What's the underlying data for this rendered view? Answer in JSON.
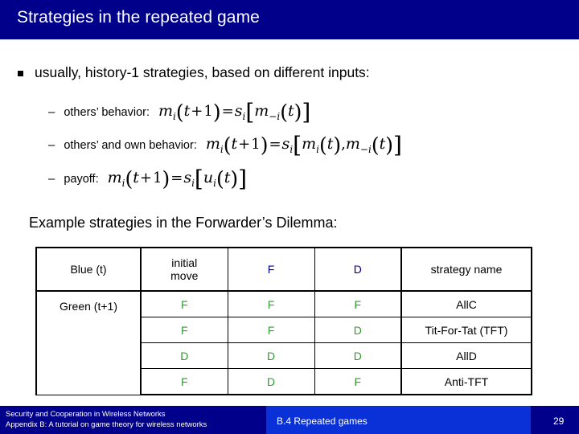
{
  "slide": {
    "title": "Strategies in the repeated game",
    "colors": {
      "title_bar": "#00008B",
      "footer_dark": "#00008B",
      "footer_bright": "#0A31D8",
      "header_accent": "#00008B",
      "cell_accent": "#2E9B2E"
    }
  },
  "bullets": {
    "main": "usually, history-1 strategies, based on different inputs:",
    "sub": [
      {
        "label": "others’ behavior:",
        "formula_text": "m_i(t+1) = s_i[ m_-i(t) ]"
      },
      {
        "label": "others’ and own behavior:",
        "formula_text": "m_i(t+1) = s_i[ m_i(t), m_-i(t) ]"
      },
      {
        "label": "payoff:",
        "formula_text": "m_i(t+1) = s_i[ u_i(t) ]"
      }
    ]
  },
  "example": {
    "caption": "Example strategies in the Forwarder’s Dilemma:"
  },
  "table": {
    "row_label_top": "Blue (t)",
    "row_label_bottom": "Green (t+1)",
    "headers": [
      "initial",
      "move",
      "F",
      "D",
      "strategy name"
    ],
    "header_initial_line1": "initial",
    "header_initial_line2": "move",
    "header_f": "F",
    "header_d": "D",
    "header_strategy_name": "strategy name",
    "rows": [
      {
        "initial": "F",
        "f": "F",
        "d": "F",
        "name": "AllC"
      },
      {
        "initial": "F",
        "f": "F",
        "d": "D",
        "name": "Tit-For-Tat (TFT)"
      },
      {
        "initial": "D",
        "f": "D",
        "d": "D",
        "name": "AllD"
      },
      {
        "initial": "F",
        "f": "D",
        "d": "F",
        "name": "Anti-TFT"
      }
    ]
  },
  "footer": {
    "line1": "Security and Cooperation in Wireless Networks",
    "line2": "Appendix B: A tutorial on game theory for wireless networks",
    "section": "B.4 Repeated games",
    "page": "29"
  }
}
